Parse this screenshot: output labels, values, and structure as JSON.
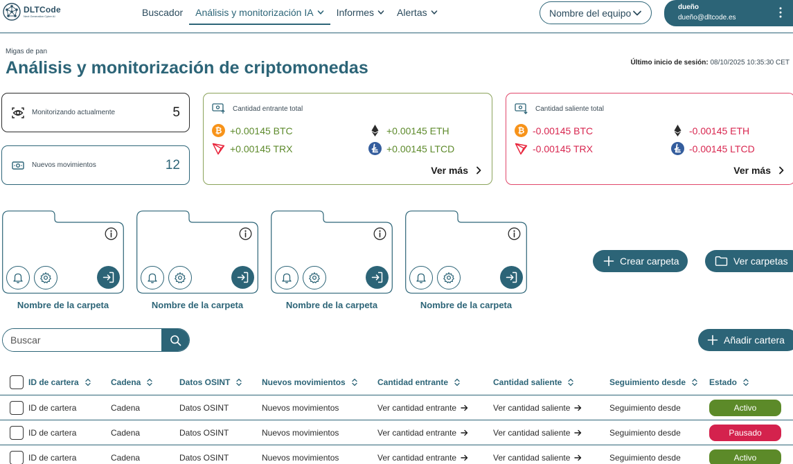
{
  "header": {
    "logo_name": "DLTCode",
    "logo_tag": "Next Generation Cyber AI",
    "nav": [
      {
        "label": "Buscador",
        "dropdown": false,
        "active": false
      },
      {
        "label": "Análisis y monitorización IA",
        "dropdown": true,
        "active": true
      },
      {
        "label": "Informes",
        "dropdown": true,
        "active": false
      },
      {
        "label": "Alertas",
        "dropdown": true,
        "active": false
      }
    ],
    "team_select": "Nombre del equipo",
    "user": {
      "name": "dueño",
      "email": "dueño@dltcode.es"
    }
  },
  "page": {
    "breadcrumb": "Migas de pan",
    "title": "Análisis y monitorización de criptomonedas",
    "last_login_label": "Último inicio de sesión:",
    "last_login_value": "08/10/2025 10:35:30 CET"
  },
  "stats": {
    "monitoring": {
      "label": "Monitorizando actualmente",
      "value": "5"
    },
    "new_movements": {
      "label": "Nuevos movimientos",
      "value": "12"
    },
    "incoming": {
      "label": "Cantidad entrante total",
      "items": [
        {
          "coin": "bitcoin",
          "text": "+0.00145 BTC"
        },
        {
          "coin": "ethereum",
          "text": "+0.00145 ETH"
        },
        {
          "coin": "tron",
          "text": "+0.00145 TRX"
        },
        {
          "coin": "litecoin",
          "text": "+0.00145 LTCD"
        }
      ],
      "see_more": "Ver más"
    },
    "outgoing": {
      "label": "Cantidad saliente total",
      "items": [
        {
          "coin": "bitcoin",
          "text": "-0.00145 BTC"
        },
        {
          "coin": "ethereum",
          "text": "-0.00145 ETH"
        },
        {
          "coin": "tron",
          "text": "-0.00145 TRX"
        },
        {
          "coin": "litecoin",
          "text": "-0.00145 LTCD"
        }
      ],
      "see_more": "Ver más"
    }
  },
  "folders": {
    "items": [
      {
        "name": "Nombre de la carpeta"
      },
      {
        "name": "Nombre de la carpeta"
      },
      {
        "name": "Nombre de la carpeta"
      },
      {
        "name": "Nombre de la carpeta"
      }
    ],
    "create_label": "Crear carpeta",
    "view_label": "Ver carpetas"
  },
  "search": {
    "placeholder": "Buscar"
  },
  "add_wallet_label": "Añadir cartera",
  "table": {
    "columns": [
      "ID de cartera",
      "Cadena",
      "Datos OSINT",
      "Nuevos movimientos",
      "Cantidad entrante",
      "Cantidad saliente",
      "Seguimiento desde",
      "Estado"
    ],
    "rows": [
      {
        "id": "ID de cartera",
        "chain": "Cadena",
        "osint": "Datos OSINT",
        "movements": "Nuevos movimientos",
        "incoming": "Ver cantidad entrante",
        "outgoing": "Ver cantidad saliente",
        "since": "Seguimiento desde",
        "status": "Activo"
      },
      {
        "id": "ID de cartera",
        "chain": "Cadena",
        "osint": "Datos OSINT",
        "movements": "Nuevos movimientos",
        "incoming": "Ver cantidad entrante",
        "outgoing": "Ver cantidad saliente",
        "since": "Seguimiento desde",
        "status": "Pausado"
      },
      {
        "id": "ID de cartera",
        "chain": "Cadena",
        "osint": "Datos OSINT",
        "movements": "Nuevos movimientos",
        "incoming": "Ver cantidad entrante",
        "outgoing": "Ver cantidad saliente",
        "since": "Seguimiento desde",
        "status": "Activo"
      }
    ]
  },
  "colors": {
    "primary": "#2c6477",
    "incoming": "#5d8a2b",
    "outgoing": "#d8264f",
    "status_active": "#5c8a29",
    "status_paused": "#d4224d"
  }
}
